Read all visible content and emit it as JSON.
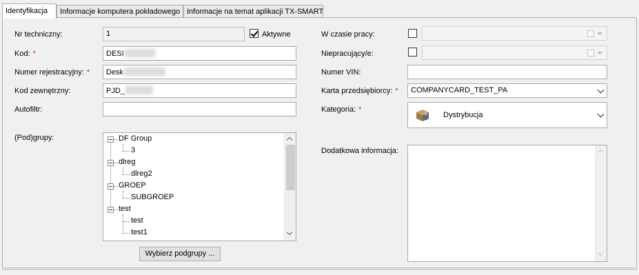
{
  "tabs": [
    {
      "label": "Identyfikacja",
      "active": true
    },
    {
      "label": "Informacje komputera pokładowego",
      "active": false
    },
    {
      "label": "Informacje na temat aplikacji TX-SMART",
      "active": false
    }
  ],
  "left": {
    "nr_techniczny": {
      "label": "Nr techniczny:",
      "value": "1"
    },
    "aktywne": {
      "label": "Aktywne",
      "checked": true
    },
    "kod": {
      "label": "Kod:",
      "required_mark": "*",
      "value": "DESI"
    },
    "numer_rejestracyjny": {
      "label": "Numer rejestracyjny:",
      "required_mark": "*",
      "value": "Desk"
    },
    "kod_zewnetrzny": {
      "label": "Kod zewnętrzny:",
      "value": "PJD_"
    },
    "autofiltr": {
      "label": "Autofiltr:",
      "value": ""
    },
    "podgrupy": {
      "label": "(Pod)grupy:",
      "tree": [
        {
          "label": "DF Group",
          "children": [
            "3"
          ]
        },
        {
          "label": "dlreg",
          "children": [
            "dlreg2"
          ]
        },
        {
          "label": "GROEP",
          "children": [
            "SUBGROEP"
          ]
        },
        {
          "label": "test",
          "children": [
            "test",
            "test1"
          ]
        }
      ],
      "button": "Wybierz podgrupy ..."
    }
  },
  "right": {
    "w_czasie_pracy": {
      "label": "W czasie pracy:",
      "checked": false
    },
    "niepracujacy": {
      "label": "Niepracujący/e:",
      "checked": false
    },
    "numer_vin": {
      "label": "Numer VIN:",
      "value": ""
    },
    "karta_przedsiebiorcy": {
      "label": "Karta przedsiębiorcy:",
      "required_mark": "*",
      "value": "COMPANYCARD_TEST_PA"
    },
    "kategoria": {
      "label": "Kategoria:",
      "required_mark": "*",
      "value": "Dystrybucja",
      "icon": "delivery-box-icon"
    },
    "dodatkowa_informacja": {
      "label": "Dodatkowa informacja:",
      "value": ""
    }
  },
  "colors": {
    "required": "#e02020",
    "panel_bg": "#f0f0f0"
  }
}
